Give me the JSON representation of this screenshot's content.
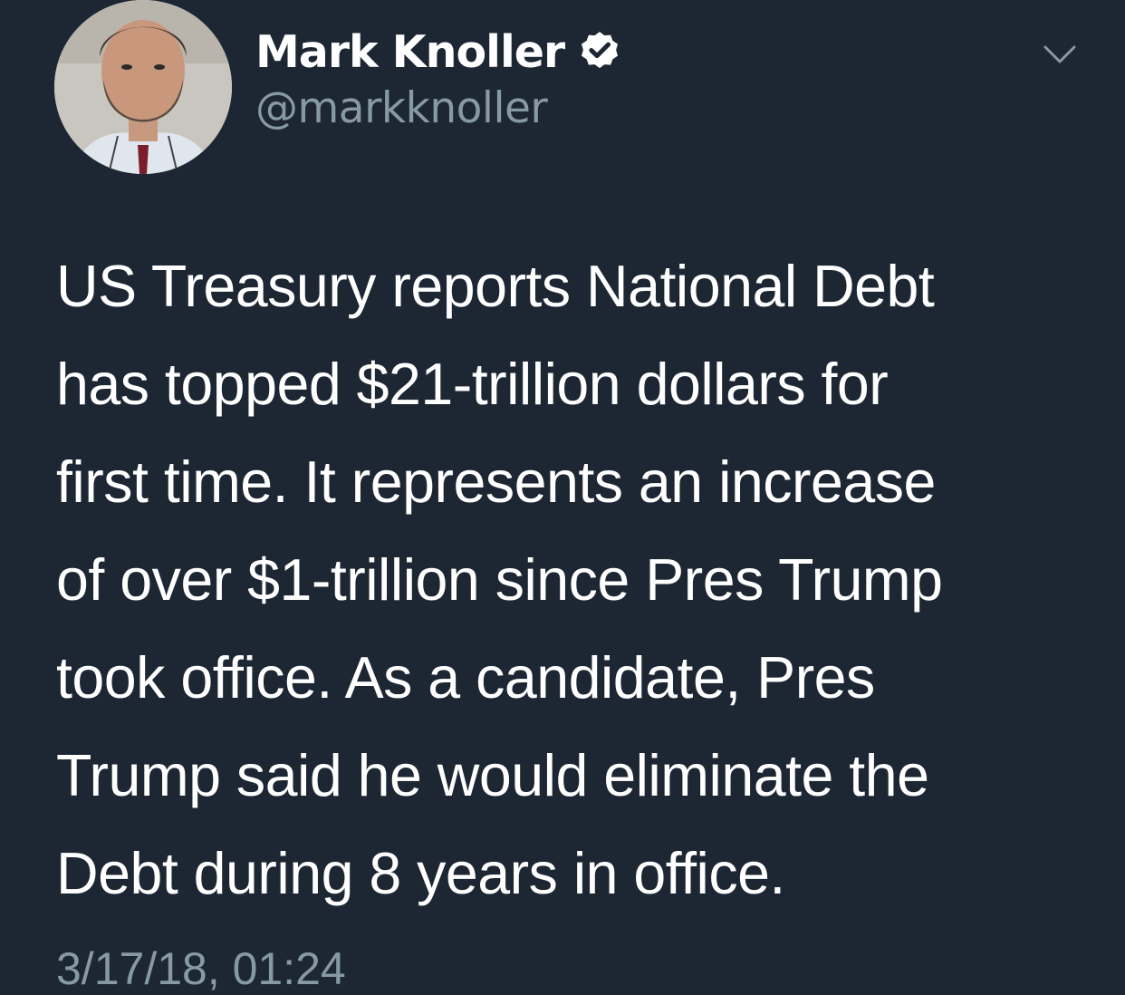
{
  "colors": {
    "background": "#1c2733",
    "primary_text": "#ffffff",
    "secondary_text": "#8899a6"
  },
  "author": {
    "display_name": "Mark Knoller",
    "handle": "@markknoller",
    "verified": true,
    "avatar_icon": "avatar-photo"
  },
  "icons": {
    "verified": "verified-badge-icon",
    "menu": "chevron-down-icon"
  },
  "tweet": {
    "text": "US Treasury reports National Debt\nhas topped $21-trillion dollars for\nfirst time. It represents an increase\nof over $1-trillion since Pres Trump\ntook office. As a candidate, Pres\nTrump said he would eliminate the\nDebt during 8 years in office.",
    "timestamp": "3/17/18, 01:24"
  }
}
